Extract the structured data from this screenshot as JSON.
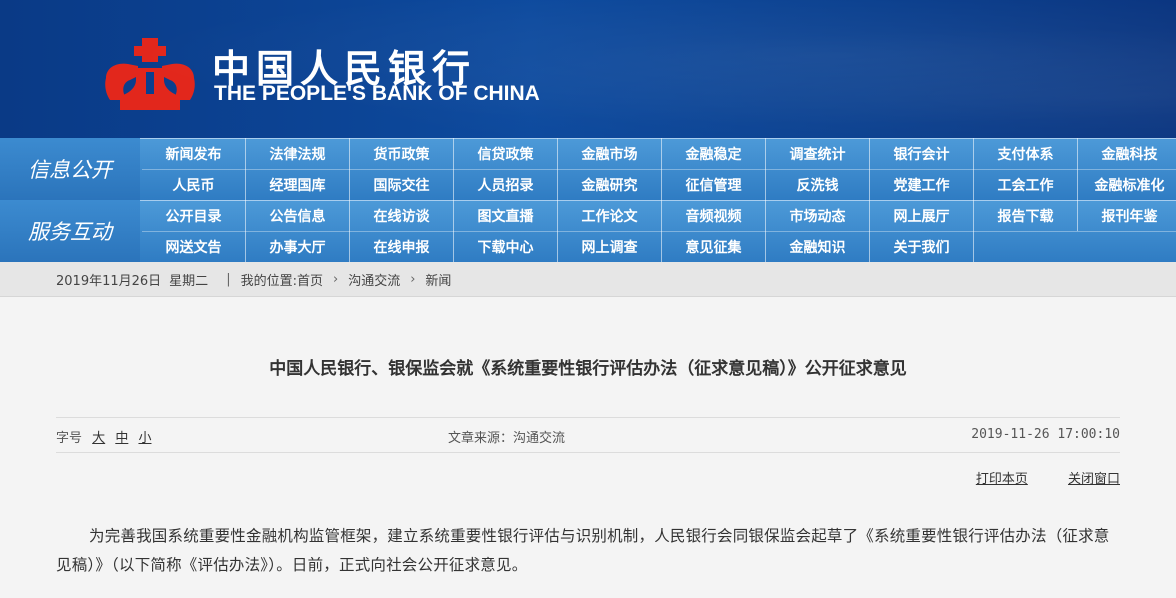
{
  "header": {
    "logo_cn": "中国人民银行",
    "logo_en": "THE PEOPLE'S BANK OF CHINA",
    "brand_color": "#0a3f8e",
    "logo_color": "#e2271c"
  },
  "nav_info": {
    "title": "信息公开",
    "row1": [
      "新闻发布",
      "法律法规",
      "货币政策",
      "信贷政策",
      "金融市场",
      "金融稳定",
      "调查统计",
      "银行会计",
      "支付体系",
      "金融科技"
    ],
    "row2": [
      "人民币",
      "经理国库",
      "国际交往",
      "人员招录",
      "金融研究",
      "征信管理",
      "反洗钱",
      "党建工作",
      "工会工作",
      "金融标准化"
    ]
  },
  "nav_service": {
    "title": "服务互动",
    "row1": [
      "公开目录",
      "公告信息",
      "在线访谈",
      "图文直播",
      "工作论文",
      "音频视频",
      "市场动态",
      "网上展厅",
      "报告下载",
      "报刊年鉴"
    ],
    "row2": [
      "网送文告",
      "办事大厅",
      "在线申报",
      "下载中心",
      "网上调查",
      "意见征集",
      "金融知识",
      "关于我们"
    ]
  },
  "breadcrumb": {
    "date": "2019年11月26日",
    "weekday": "星期二",
    "location_label": "我的位置:",
    "items": [
      "首页",
      "沟通交流",
      "新闻"
    ]
  },
  "article": {
    "title": "中国人民银行、银保监会就《系统重要性银行评估办法（征求意见稿）》公开征求意见",
    "fontsize_label": "字号",
    "fontsize_options": [
      "大",
      "中",
      "小"
    ],
    "source": "文章来源：沟通交流",
    "datetime": "2019-11-26 17:00:10",
    "print_label": "打印本页",
    "close_label": "关闭窗口",
    "body": "为完善我国系统重要性金融机构监管框架，建立系统重要性银行评估与识别机制，人民银行会同银保监会起草了《系统重要性银行评估办法（征求意见稿）》（以下简称《评估办法》）。日前，正式向社会公开征求意见。"
  }
}
